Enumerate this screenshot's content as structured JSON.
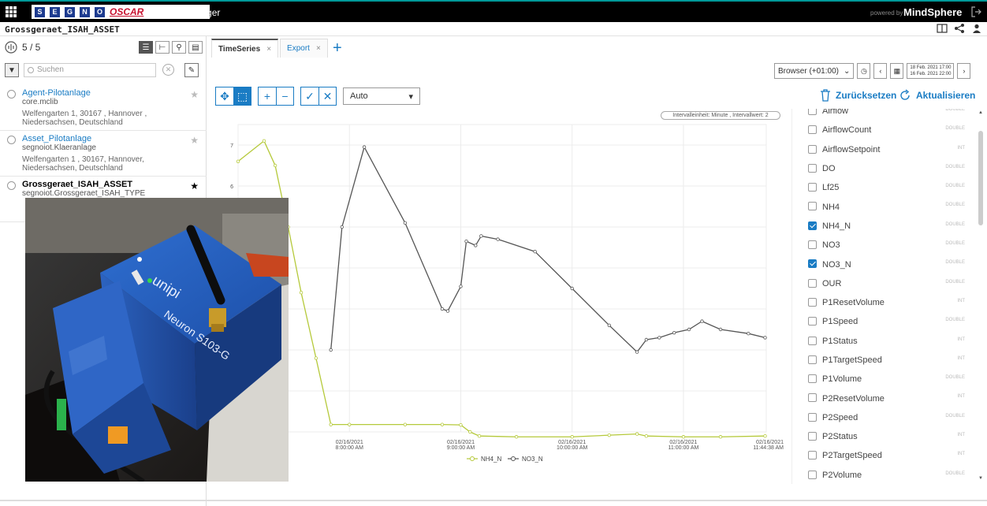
{
  "header": {
    "logo_letters": [
      "S",
      "E",
      "G",
      "N",
      "O"
    ],
    "logo_word": "OSCAR",
    "app_name": "Fleet Manager",
    "powered_by": "powered by",
    "brand": "MindSphere"
  },
  "asset_bar": {
    "title": "Grossgeraet_ISAH_ASSET"
  },
  "left_panel": {
    "count": "5 / 5",
    "search_placeholder": "Suchen",
    "items": [
      {
        "name": "Agent-Pilotanlage",
        "type": "core.mclib",
        "address": "Welfengarten 1, 30167 , Hannover , Niedersachsen, Deutschland",
        "selected": false
      },
      {
        "name": "Asset_Pilotanlage",
        "type": "segnoiot.Klaeranlage",
        "address": "Welfengarten 1 , 30167, Hannover, Niedersachsen, Deutschland",
        "selected": false
      },
      {
        "name": "Grossgeraet_ISAH_ASSET",
        "type": "segnoiot.Grossgeraet_ISAH_TYPE",
        "address": "",
        "selected": true
      }
    ]
  },
  "tabs": [
    {
      "label": "TimeSeries",
      "active": true
    },
    {
      "label": "Export",
      "active": false
    }
  ],
  "time_controls": {
    "timezone": "Browser (+01:00)",
    "from": "18 Feb. 2021 17:00",
    "to": "16 Feb. 2021 22:00"
  },
  "toolbar": {
    "aggregation": "Auto",
    "reset_label": "Zurücksetzen",
    "refresh_label": "Aktualisieren"
  },
  "interval_label": "Intervalleinheit: Minute , Intervallwert: 2",
  "chart_data": {
    "type": "line",
    "x_tick_labels": [
      [
        "02/16/2021",
        "8:00:00 AM"
      ],
      [
        "02/16/2021",
        "9:00:00 AM"
      ],
      [
        "02/16/2021",
        "10:00:00 AM"
      ],
      [
        "02/16/2021",
        "11:00:00 AM"
      ],
      [
        "02/16/2021",
        "11:44:38 AM"
      ]
    ],
    "y_ticks": [
      7,
      6
    ],
    "ylim": [
      0,
      7.5
    ],
    "colors": {
      "NH4_N": "#b5c93a",
      "NO3_N": "#555555"
    },
    "series": [
      {
        "name": "NH4_N",
        "x": [
          "07:00",
          "07:14",
          "07:20",
          "07:27",
          "07:34",
          "07:42",
          "07:50",
          "08:00",
          "08:30",
          "08:50",
          "09:00",
          "09:05",
          "09:10",
          "09:30",
          "10:00",
          "10:20",
          "10:35",
          "10:40",
          "11:00",
          "11:20",
          "11:44"
        ],
        "values": [
          6.6,
          7.1,
          6.5,
          5.0,
          3.4,
          1.8,
          0.18,
          0.18,
          0.18,
          0.18,
          0.17,
          0.0,
          -0.1,
          -0.12,
          -0.12,
          -0.08,
          -0.05,
          -0.1,
          -0.12,
          -0.12,
          -0.1
        ]
      },
      {
        "name": "NO3_N",
        "x": [
          "07:50",
          "07:56",
          "08:08",
          "08:30",
          "08:50",
          "08:53",
          "09:00",
          "09:03",
          "09:08",
          "09:11",
          "09:20",
          "09:40",
          "10:00",
          "10:20",
          "10:35",
          "10:40",
          "10:47",
          "10:55",
          "11:03",
          "11:10",
          "11:20",
          "11:35",
          "11:44"
        ],
        "values": [
          2.0,
          5.0,
          6.95,
          5.1,
          3.0,
          2.95,
          3.55,
          4.65,
          4.55,
          4.78,
          4.7,
          4.4,
          3.5,
          2.6,
          1.95,
          2.25,
          2.3,
          2.42,
          2.5,
          2.7,
          2.5,
          2.4,
          2.3
        ]
      }
    ]
  },
  "variables": [
    {
      "name": "Airflow",
      "type": "DOUBLE",
      "checked": false
    },
    {
      "name": "AirflowCount",
      "type": "DOUBLE",
      "checked": false
    },
    {
      "name": "AirflowSetpoint",
      "type": "INT",
      "checked": false
    },
    {
      "name": "DO",
      "type": "DOUBLE",
      "checked": false
    },
    {
      "name": "Lf25",
      "type": "DOUBLE",
      "checked": false
    },
    {
      "name": "NH4",
      "type": "DOUBLE",
      "checked": false
    },
    {
      "name": "NH4_N",
      "type": "DOUBLE",
      "checked": true
    },
    {
      "name": "NO3",
      "type": "DOUBLE",
      "checked": false
    },
    {
      "name": "NO3_N",
      "type": "DOUBLE",
      "checked": true
    },
    {
      "name": "OUR",
      "type": "DOUBLE",
      "checked": false
    },
    {
      "name": "P1ResetVolume",
      "type": "INT",
      "checked": false
    },
    {
      "name": "P1Speed",
      "type": "DOUBLE",
      "checked": false
    },
    {
      "name": "P1Status",
      "type": "INT",
      "checked": false
    },
    {
      "name": "P1TargetSpeed",
      "type": "INT",
      "checked": false
    },
    {
      "name": "P1Volume",
      "type": "DOUBLE",
      "checked": false
    },
    {
      "name": "P2ResetVolume",
      "type": "INT",
      "checked": false
    },
    {
      "name": "P2Speed",
      "type": "DOUBLE",
      "checked": false
    },
    {
      "name": "P2Status",
      "type": "INT",
      "checked": false
    },
    {
      "name": "P2TargetSpeed",
      "type": "INT",
      "checked": false
    },
    {
      "name": "P2Volume",
      "type": "DOUBLE",
      "checked": false
    }
  ],
  "photo": {
    "device_brand": "unipi",
    "device_model": "Neuron S103-G"
  }
}
